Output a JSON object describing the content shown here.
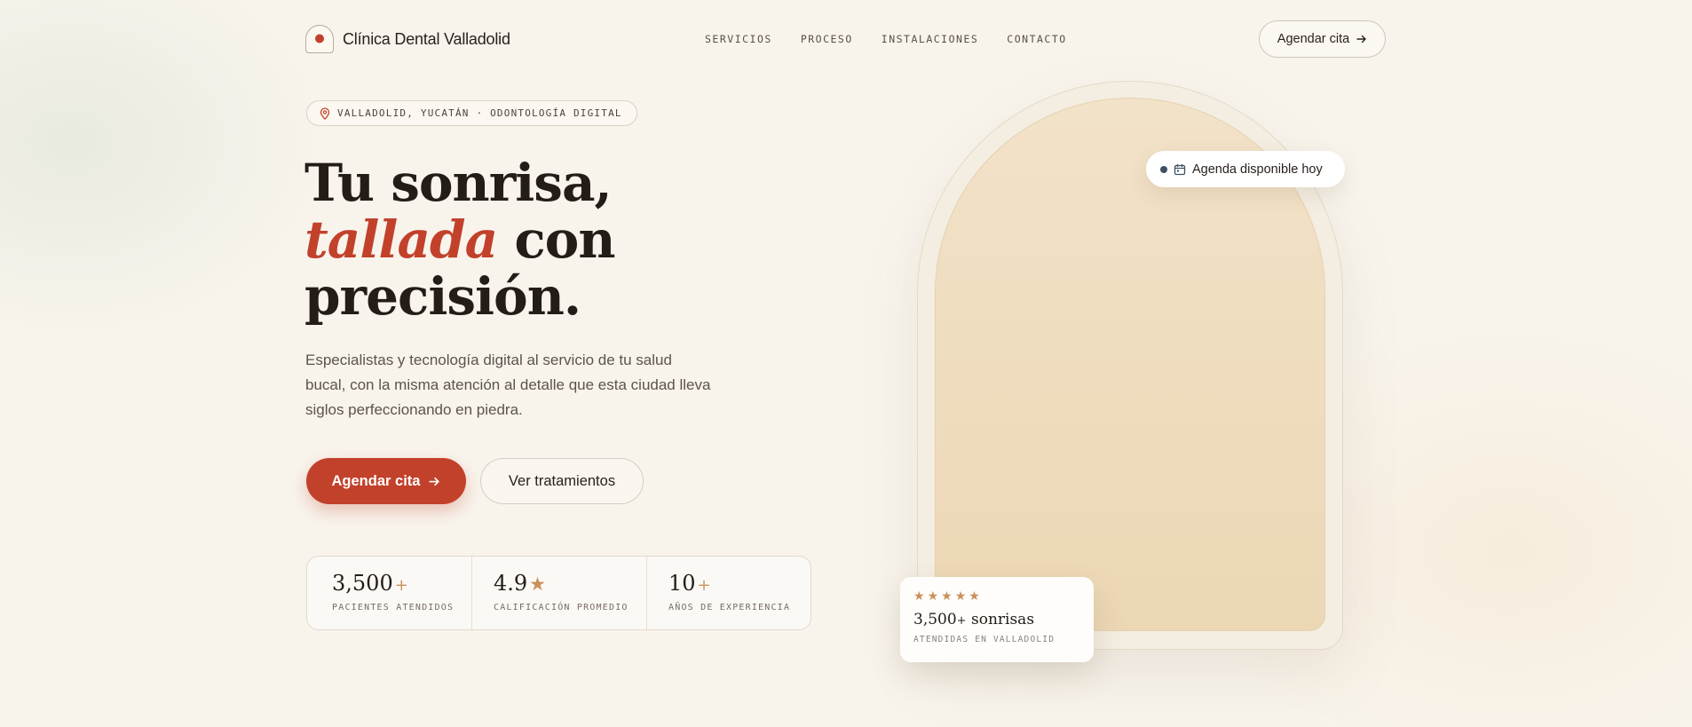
{
  "header": {
    "logo_text": "Clínica Dental Valladolid",
    "nav": [
      "SERVICIOS",
      "PROCESO",
      "INSTALACIONES",
      "CONTACTO"
    ],
    "cta_label": "Agendar cita"
  },
  "hero": {
    "location_badge": "VALLADOLID, YUCATÁN · ODONTOLOGÍA DIGITAL",
    "title_line1": "Tu sonrisa,",
    "title_accent": "tallada",
    "title_line2_rest": " con",
    "title_line3": "precisión.",
    "subtitle": "Especialistas y tecnología digital al servicio de tu salud bucal, con la misma atención al detalle que esta ciudad lleva siglos perfeccionando en piedra.",
    "primary_cta": "Agendar cita",
    "secondary_cta": "Ver tratamientos"
  },
  "stats": [
    {
      "value": "3,500",
      "suffix": "+",
      "label": "PACIENTES ATENDIDOS"
    },
    {
      "value": "4.9",
      "suffix": "★",
      "label": "CALIFICACIÓN PROMEDIO"
    },
    {
      "value": "10",
      "suffix": "+",
      "label": "AÑOS DE EXPERIENCIA"
    }
  ],
  "arch": {
    "availability_badge": "Agenda disponible hoy",
    "card": {
      "rating_stars": 5,
      "title_value": "3,500",
      "title_suffix": "+",
      "title_rest": " sonrisas",
      "subtitle": "ATENDIDAS EN VALLADOLID"
    }
  },
  "colors": {
    "accent": "#c2412b",
    "gold": "#c9905a",
    "background": "#f8f4ec",
    "text": "#241c17"
  },
  "icons": [
    "map-pin-icon",
    "arrow-right-icon",
    "calendar-icon",
    "star-icon"
  ]
}
